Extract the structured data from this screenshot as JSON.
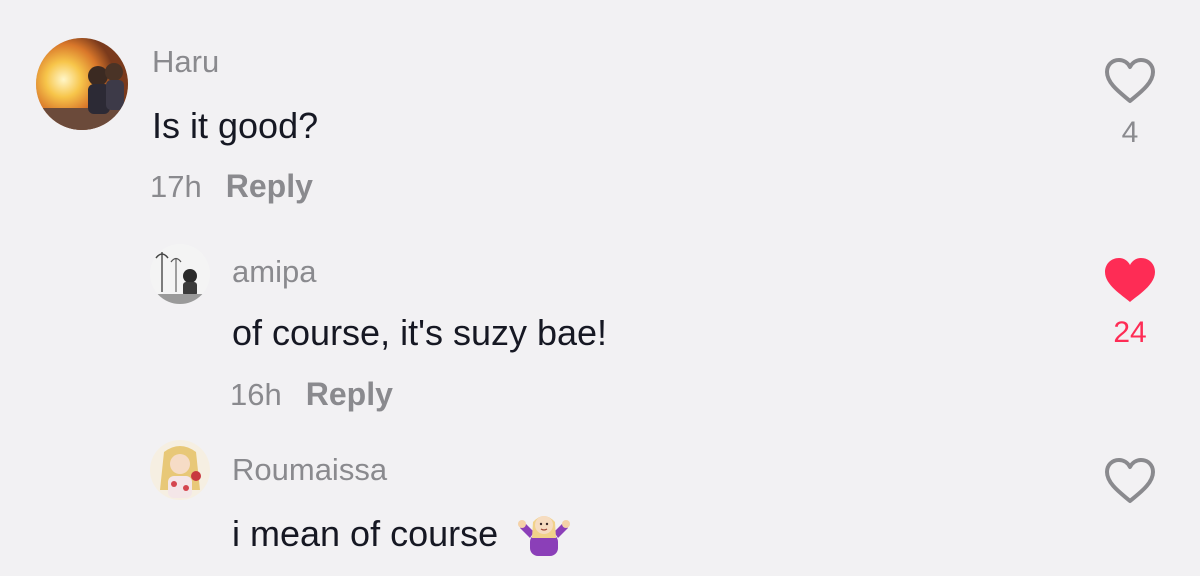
{
  "colors": {
    "background": "#f2f1f3",
    "muted_text": "#8a8a8e",
    "body_text": "#161823",
    "liked": "#fe2c55",
    "heart_outline": "#8a8a8e"
  },
  "comments": [
    {
      "username": "Haru",
      "text": "Is it good?",
      "time": "17h",
      "reply_label": "Reply",
      "like_count": "4",
      "liked": false,
      "avatar_icon": "avatar-photo-haru"
    },
    {
      "username": "amipa",
      "text": "of course, it's suzy bae!",
      "time": "16h",
      "reply_label": "Reply",
      "like_count": "24",
      "liked": true,
      "avatar_icon": "avatar-photo-amipa"
    },
    {
      "username": "Roumaissa",
      "text": "i mean of course",
      "emoji_icon": "shrugging-woman-emoji",
      "liked": false,
      "avatar_icon": "avatar-illustration-roumaissa"
    }
  ]
}
